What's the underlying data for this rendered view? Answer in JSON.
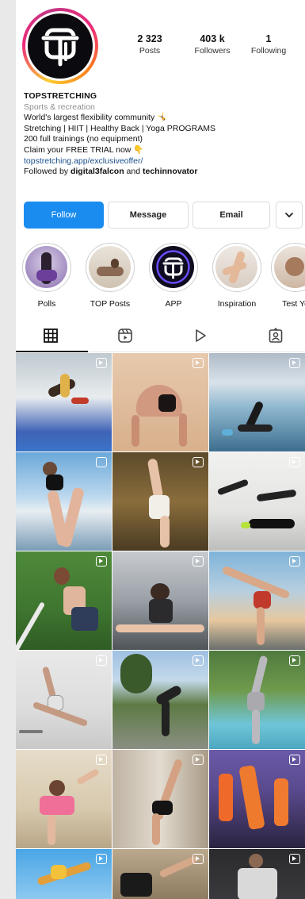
{
  "profile": {
    "username": "TOPSTRETCHING",
    "category": "Sports & recreation",
    "bio_lines": [
      "World's largest flexibility community 🤸",
      "Stretching | HIIT | Healthy Back | Yoga PROGRAMS",
      "200 full trainings (no equipment)",
      "Claim your FREE TRIAL now 👇"
    ],
    "link": "topstretching.app/exclusiveoffer/",
    "followed_by_prefix": "Followed by ",
    "followed_by_1": "digital3falcon",
    "followed_by_and": " and ",
    "followed_by_2": "techinnovator"
  },
  "stats": {
    "posts_count": "2 323",
    "posts_label": "Posts",
    "followers_count": "403 k",
    "followers_label": "Followers",
    "following_count": "1",
    "following_label": "Following"
  },
  "buttons": {
    "follow": "Follow",
    "message": "Message",
    "email": "Email",
    "more_icon": "chevron-down-icon"
  },
  "highlights": [
    {
      "label": "Polls"
    },
    {
      "label": "TOP Posts"
    },
    {
      "label": "APP"
    },
    {
      "label": "Inspiration"
    },
    {
      "label": "Test Yo"
    }
  ],
  "tabs": [
    "grid-icon",
    "reels-icon",
    "play-icon",
    "tagged-icon"
  ],
  "colors": {
    "follow_blue": "#1a8cf0",
    "link_blue": "#1a4f8b",
    "ring_gradient_start": "#f9ce34",
    "ring_gradient_mid": "#ee2a7b"
  },
  "posts": [
    {
      "type": "reel"
    },
    {
      "type": "reel"
    },
    {
      "type": "reel"
    },
    {
      "type": "carousel"
    },
    {
      "type": "reel"
    },
    {
      "type": "reel"
    },
    {
      "type": "reel"
    },
    {
      "type": "reel"
    },
    {
      "type": "reel"
    },
    {
      "type": "reel"
    },
    {
      "type": "reel"
    },
    {
      "type": "reel"
    },
    {
      "type": "reel"
    },
    {
      "type": "reel"
    },
    {
      "type": "reel"
    },
    {
      "type": "reel"
    },
    {
      "type": "reel"
    },
    {
      "type": "reel"
    }
  ]
}
